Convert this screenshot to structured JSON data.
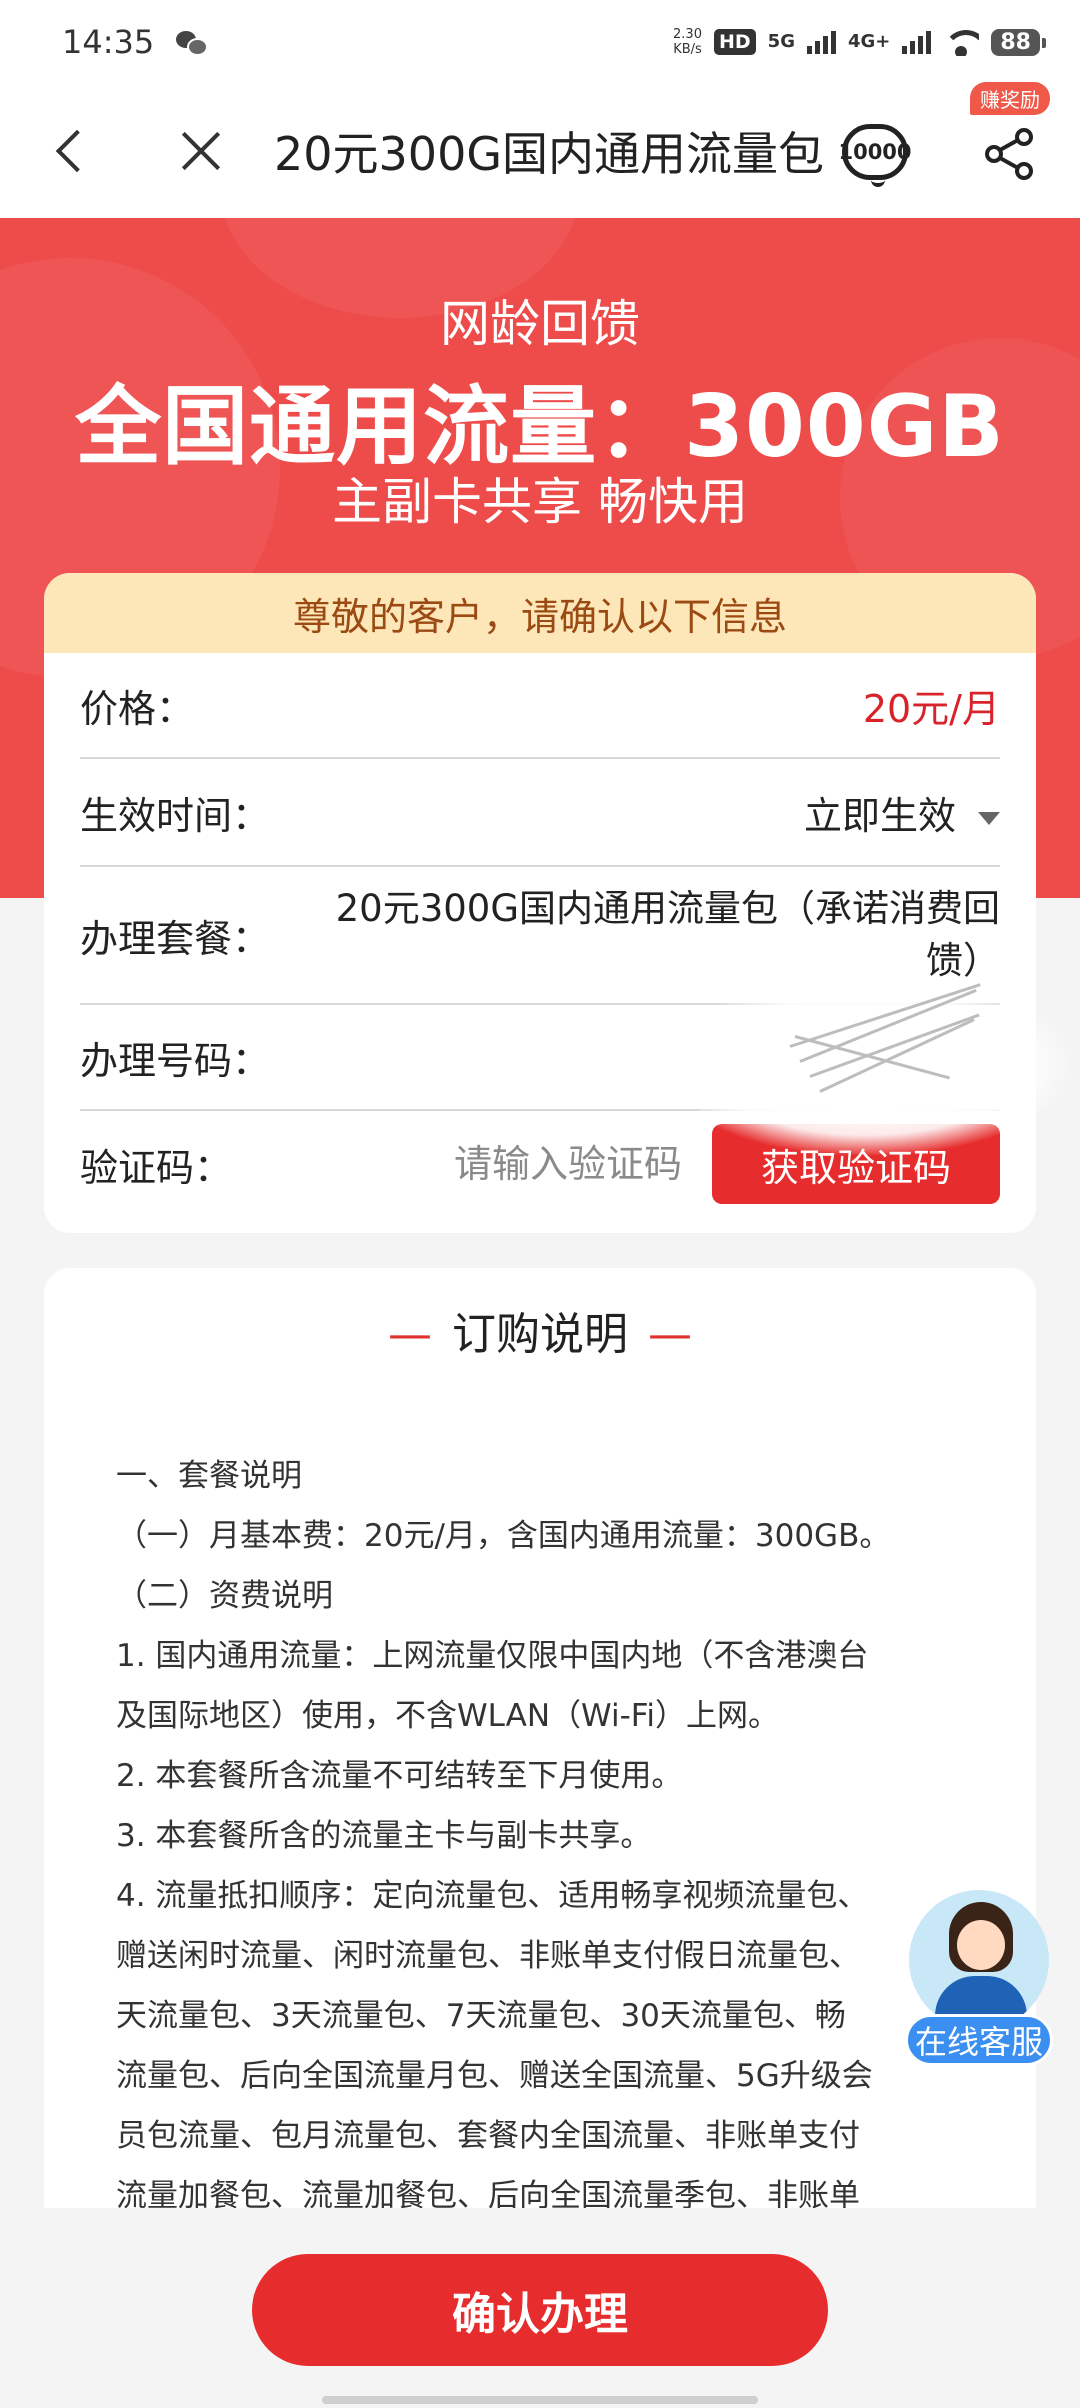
{
  "status_bar": {
    "time": "14:35",
    "speed_value": "2.30",
    "speed_unit": "KB/s",
    "hd": "HD",
    "net1": "5G",
    "net2": "4G+",
    "battery": "88"
  },
  "nav": {
    "title": "20元300G国内通用流量包",
    "service_label": "10000",
    "badge": "赚奖励"
  },
  "banner": {
    "sub1": "网龄回馈",
    "headline": "全国通用流量：300GB",
    "sub2": "主副卡共享 畅快用"
  },
  "form": {
    "header": "尊敬的客户，请确认以下信息",
    "price_label": "价格：",
    "price_value": "20元/月",
    "time_label": "生效时间：",
    "time_value": "立即生效",
    "package_label": "办理套餐：",
    "package_value": "20元300G国内通用流量包（承诺消费回馈）",
    "number_label": "办理号码：",
    "code_label": "验证码：",
    "code_placeholder": "请输入验证码",
    "code_button": "获取验证码"
  },
  "info": {
    "title": "订购说明",
    "lines": [
      "一、套餐说明",
      "（一）月基本费：20元/月，含国内通用流量：300GB。",
      "（二）资费说明",
      "1. 国内通用流量：上网流量仅限中国内地（不含港澳台",
      "及国际地区）使用，不含WLAN（Wi-Fi）上网。",
      "2. 本套餐所含流量不可结转至下月使用。",
      "3. 本套餐所含的流量主卡与副卡共享。",
      "4. 流量抵扣顺序：定向流量包、适用畅享视频流量包、",
      "赠送闲时流量、闲时流量包、非账单支付假日流量包、",
      "天流量包、3天流量包、7天流量包、30天流量包、畅",
      "流量包、后向全国流量月包、赠送全国流量、5G升级会",
      "员包流量、包月流量包、套餐内全国流量、非账单支付",
      "流量加餐包、流量加餐包、后向全国流量季包、非账单"
    ]
  },
  "float_service": {
    "label": "在线客服"
  },
  "bottom": {
    "confirm": "确认办理"
  },
  "colors": {
    "brand_red": "#ee4b4b",
    "button_red": "#e62c2c",
    "header_cream": "#fde6b8",
    "service_blue": "#3a8ff0"
  }
}
